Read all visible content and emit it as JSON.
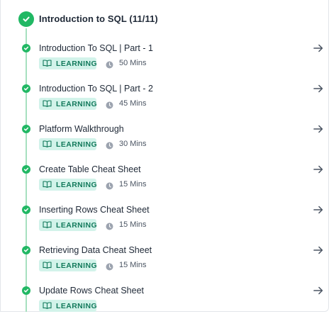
{
  "section": {
    "title": "Introduction to SQL (11/11)",
    "status_icon": "check-circle-icon",
    "accent_color": "#21b864"
  },
  "items": [
    {
      "title": "Introduction To SQL | Part - 1",
      "badge": "LEARNING",
      "duration": "50 Mins"
    },
    {
      "title": "Introduction To SQL | Part - 2",
      "badge": "LEARNING",
      "duration": "45 Mins"
    },
    {
      "title": "Platform Walkthrough",
      "badge": "LEARNING",
      "duration": "30 Mins"
    },
    {
      "title": "Create Table Cheat Sheet",
      "badge": "LEARNING",
      "duration": "15 Mins"
    },
    {
      "title": "Inserting Rows Cheat Sheet",
      "badge": "LEARNING",
      "duration": "15 Mins"
    },
    {
      "title": "Retrieving Data Cheat Sheet",
      "badge": "LEARNING",
      "duration": "15 Mins"
    },
    {
      "title": "Update Rows Cheat Sheet",
      "badge": "LEARNING",
      "duration": ""
    }
  ],
  "icons": {
    "completed": "check-icon",
    "badge": "book-open-icon",
    "duration": "clock-icon",
    "open": "arrow-right-icon"
  },
  "colors": {
    "badge_bg": "#d2f3ea",
    "badge_text": "#137a5c",
    "timeline": "#a6e0bf"
  }
}
